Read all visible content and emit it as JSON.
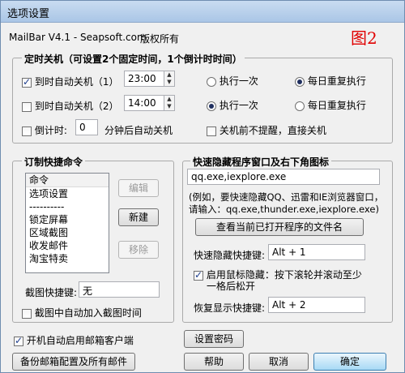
{
  "window": {
    "title": "选项设置"
  },
  "header": {
    "product": "MailBar V4.1 - Seapsoft.com",
    "copyright": "版权所有",
    "figure_label": "图2"
  },
  "timer_group": {
    "title": "定时关机（可设置2个固定时间，1个倒计时时间）",
    "row1": {
      "label": "到时自动关机（1）",
      "time": "23:00",
      "opt_once": "执行一次",
      "opt_daily": "每日重复执行"
    },
    "row2": {
      "label": "到时自动关机（2）",
      "time": "14:00",
      "opt_once": "执行一次",
      "opt_daily": "每日重复执行"
    },
    "countdown": {
      "label": "倒计时:",
      "value": "0",
      "suffix": "分钟后自动关机"
    },
    "no_prompt": "关机前不提醒，直接关机"
  },
  "cmd_group": {
    "title": "订制快捷命令",
    "list_items": [
      "命令",
      "选项设置",
      "----------",
      "锁定屏幕",
      "区域截图",
      "收发邮件",
      "淘宝特卖"
    ],
    "edit_btn": "编辑",
    "new_btn": "新建",
    "remove_btn": "移除",
    "shot_label": "截图快捷键:",
    "shot_value": "无",
    "auto_add": "截图中自动加入截图时间"
  },
  "hide_group": {
    "title": "快速隐藏程序窗口及右下角图标",
    "programs": "qq.exe,iexplore.exe",
    "hint1": "(例如，要快速隐藏QQ、迅雷和IE浏览器窗口，",
    "hint2": "请输入：qq.exe,thunder.exe,iexplore.exe)",
    "view_btn": "查看当前已打开程序的文件名",
    "hide_key_label": "快速隐藏快捷键:",
    "hide_key_value": "Alt + 1",
    "mouse_hide_line1": "启用鼠标隐藏：按下滚轮并滚动至少",
    "mouse_hide_line2": "一格后松开",
    "restore_label": "恢复显示快捷键:",
    "restore_value": "Alt + 2"
  },
  "bottom": {
    "autostart": "开机自动启用邮箱客户端",
    "set_password": "设置密码",
    "backup": "备份邮箱配置及所有邮件",
    "help": "帮助",
    "cancel": "取消",
    "ok": "确定"
  }
}
